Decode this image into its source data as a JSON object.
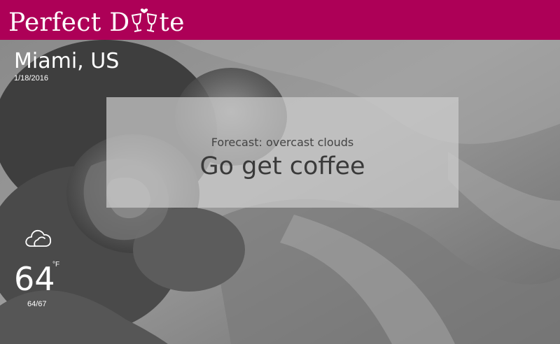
{
  "header": {
    "brand_before": "Perfect D",
    "brand_after": "te",
    "brand_icon": "wine-glasses-heart-icon",
    "brand_color": "#ad0057"
  },
  "location": {
    "city": "Miami, US",
    "date": "1/18/2016"
  },
  "forecast": {
    "summary": "Forecast: overcast clouds",
    "advice": "Go get coffee"
  },
  "weather": {
    "icon": "cloud-icon",
    "temperature": "64",
    "unit": "°F",
    "range": "64/67"
  }
}
